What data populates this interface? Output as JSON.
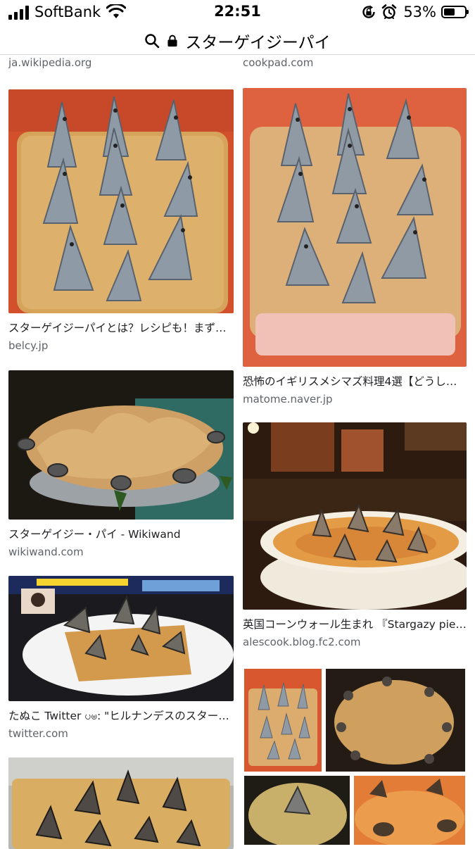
{
  "status": {
    "carrier": "SoftBank",
    "time": "22:51",
    "battery_percent": "53%",
    "battery_level": 0.53,
    "icons": [
      "signal-icon",
      "wifi-icon",
      "rotation-lock-icon",
      "alarm-icon",
      "battery-icon"
    ]
  },
  "address": {
    "query": "スターゲイジーパイ",
    "icons": [
      "search-icon",
      "lock-icon"
    ]
  },
  "top_sources": {
    "left": "ja.wikipedia.org",
    "right": "cookpad.com"
  },
  "results": {
    "left": [
      {
        "title": "スターゲイジーパイとは？レシピも！まずい…",
        "source": "belcy.jp"
      },
      {
        "title": "スターゲイジー・パイ - Wikiwand",
        "source": "wikiwand.com"
      },
      {
        "title": "たぬこ Twitter ပၑ: \"ヒルナンデスのスター…",
        "source": "twitter.com"
      },
      {
        "title": "",
        "source": ""
      }
    ],
    "right": [
      {
        "title": "恐怖のイギリスメシマズ料理4選【どうし…",
        "source": "matome.naver.jp"
      },
      {
        "title": "英国コーンウォール生まれ 『Stargazy pie…",
        "source": "alescook.blog.fc2.com"
      },
      {
        "title": "",
        "source": ""
      }
    ]
  },
  "colors": {
    "source_gray": "#5f6368",
    "title_text": "#202124",
    "tile_bg_red": "#d9532f",
    "pastry": "#d9a55a",
    "fish_silver": "#8a96a3",
    "dark_bg": "#1b1712"
  }
}
